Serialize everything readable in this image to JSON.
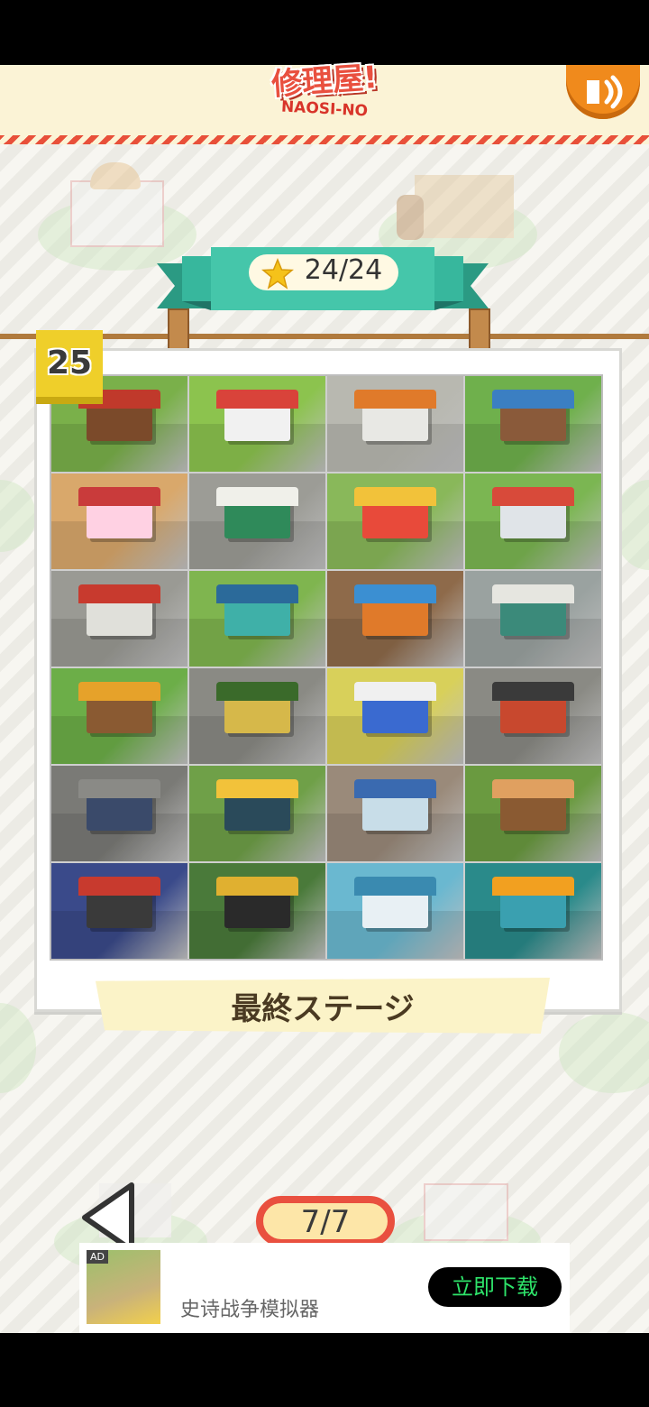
{
  "header": {
    "logo_text": "修理屋!",
    "logo_subtitle": "NAOSI-NO",
    "sound_icon": "speaker-icon"
  },
  "progress": {
    "star_icon": "star-icon",
    "stars_label": "24/24"
  },
  "stage": {
    "number": "25",
    "title": "最終ステージ",
    "buildings": [
      "coffee-shop-building",
      "burger-shop-building",
      "gas-station-building",
      "christmas-house-building",
      "ufo-catcher-building",
      "flower-shop-building",
      "circus-tent-building",
      "food-truck-building",
      "post-office-building",
      "factory-building",
      "market-stall-building",
      "green-roof-shop-building",
      "milk-barn-building",
      "bakery-building",
      "farm-building",
      "cafe-building",
      "police-station-building",
      "ramen-building",
      "bank-building",
      "sushi-building",
      "cinema-building",
      "record-shop-building",
      "aquarium-building",
      "ship-building"
    ]
  },
  "pagination": {
    "prev_icon": "triangle-left-icon",
    "page_label": "7/7"
  },
  "ad": {
    "tag": "AD",
    "title": "史诗战争模拟器",
    "button_label": "立即下载"
  },
  "colors": {
    "accent_red": "#e9503f",
    "banner_teal": "#37b79d",
    "badge_yellow": "#efcf2a",
    "ad_button_text": "#2ee36a"
  }
}
